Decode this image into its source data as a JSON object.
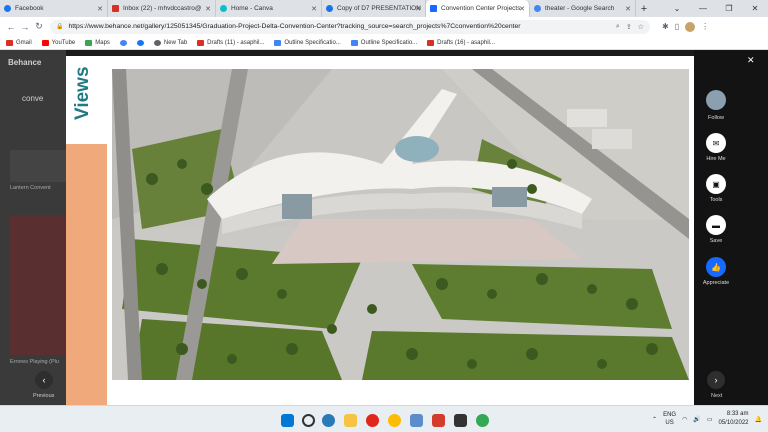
{
  "tabs": [
    {
      "label": "Facebook",
      "color": "#1877f2"
    },
    {
      "label": "Inbox (22) - mhvdccastro@",
      "color": "#d93025"
    },
    {
      "label": "Home - Canva",
      "color": "#00c4cc"
    },
    {
      "label": "Copy of D7 PRESENTATION",
      "color": "#1a73e8"
    },
    {
      "label": "Convention Center Projects",
      "color": "#1769ff",
      "active": true
    },
    {
      "label": "theater - Google Search",
      "color": "#4285f4"
    }
  ],
  "address": {
    "url": "https://www.behance.net/gallery/125051345/Graduation-Project-Delta-Convention-Center?tracking_source=search_projects%7Cconvention%20center"
  },
  "bookmarks": [
    {
      "label": "Gmail",
      "color": "#d93025"
    },
    {
      "label": "YouTube",
      "color": "#ff0000"
    },
    {
      "label": "Maps",
      "color": "#34a853"
    },
    {
      "label": "",
      "color": "#4285f4"
    },
    {
      "label": "",
      "color": "#1877f2"
    },
    {
      "label": "New Tab",
      "color": "#5f6368"
    },
    {
      "label": "Drafts (11) - asaphil...",
      "color": "#d93025"
    },
    {
      "label": "Outline Specificatio...",
      "color": "#4285f4"
    },
    {
      "label": "Outline Specificatio...",
      "color": "#4285f4"
    },
    {
      "label": "Drafts (16) - asaphil...",
      "color": "#d93025"
    }
  ],
  "behance_bg": {
    "logo": "Behance",
    "search_text": "conve",
    "card1_caption": "Lantern Convent",
    "card2_caption": "Errores Playing (Plu"
  },
  "slide": {
    "title": "Views"
  },
  "nav": {
    "prev_label": "Previous",
    "next_label": "Next"
  },
  "rail": {
    "follow": "Follow",
    "hire": "Hire Me",
    "tools": "Tools",
    "save": "Save",
    "appreciate": "Appreciate"
  },
  "taskbar": {
    "lang_top": "ENG",
    "lang_bottom": "US",
    "time": "8:33 am",
    "date": "05/10/2022"
  }
}
